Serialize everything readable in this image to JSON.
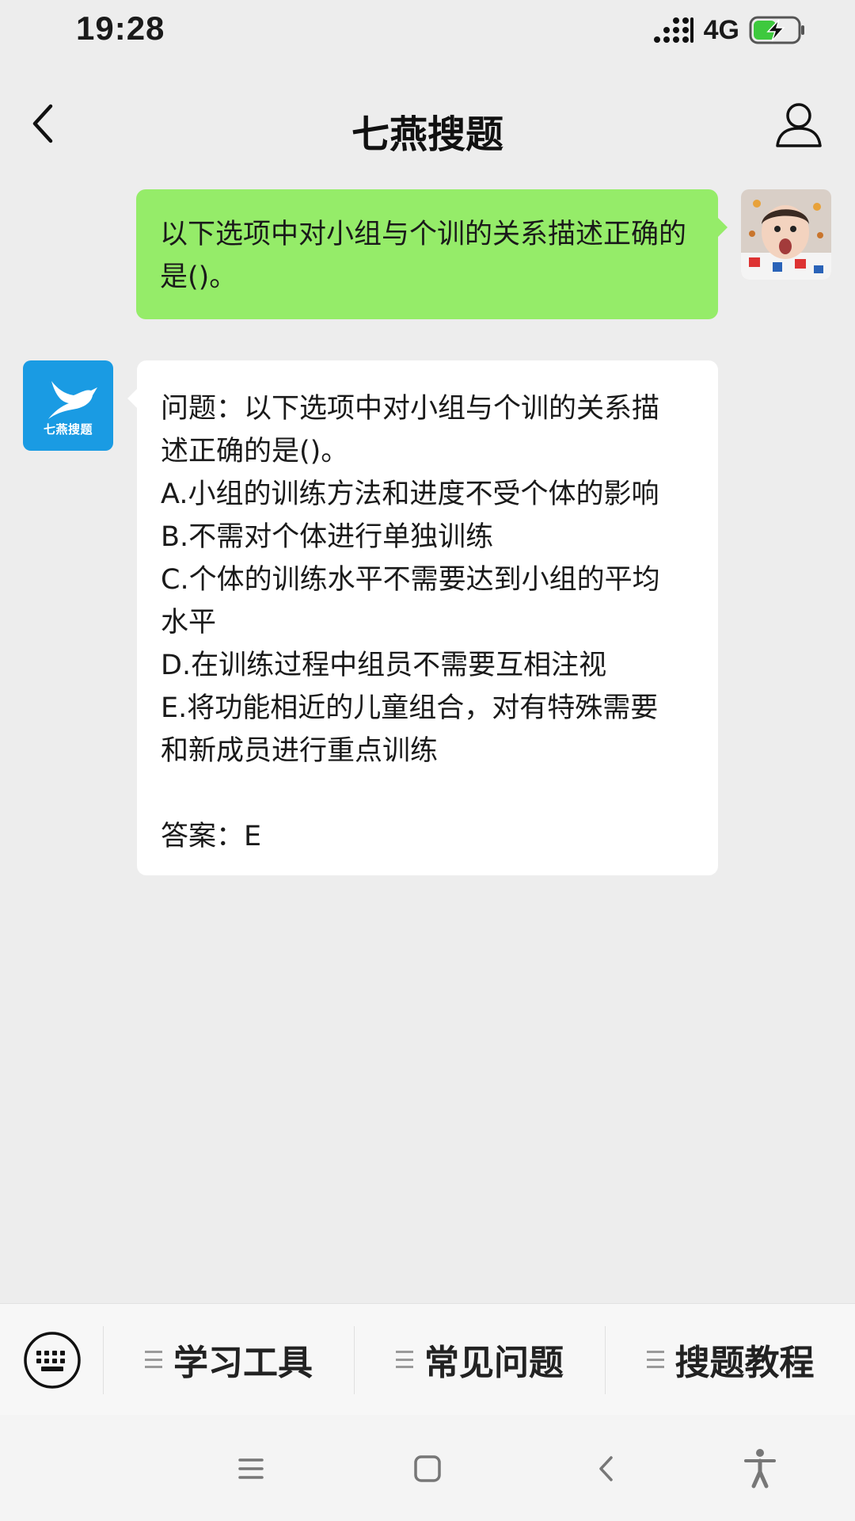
{
  "status_bar": {
    "time": "19:28",
    "network": "4G",
    "icons": [
      "signal-icon",
      "battery-charging-icon"
    ]
  },
  "nav": {
    "title": "七燕搜题",
    "icons": [
      "back-arrow-icon",
      "profile-icon"
    ]
  },
  "chat": {
    "user_message": "以下选项中对小组与个训的关系描述正确的是()。",
    "bot_avatar_label": "七燕搜题",
    "bot_reply": {
      "lines": [
        "问题：以下选项中对小组与个训的关系描",
        "述正确的是()。",
        "A.小组的训练方法和进度不受个体的影响",
        "B.不需对个体进行单独训练",
        "C.个体的训练水平不需要达到小组的平均",
        "水平",
        "D.在训练过程中组员不需要互相注视",
        "E.将功能相近的儿童组合，对有特殊需要",
        "和新成员进行重点训练"
      ],
      "answer": "答案：E"
    }
  },
  "menu": {
    "items": [
      {
        "label": "学习工具"
      },
      {
        "label": "常见问题"
      },
      {
        "label": "搜题教程"
      }
    ],
    "icons": [
      "keyboard-icon",
      "menu-lines-icon"
    ]
  },
  "system_nav": {
    "icons": [
      "recents-icon",
      "home-icon",
      "back-icon",
      "accessibility-icon"
    ]
  },
  "colors": {
    "background": "#ededed",
    "user_bubble": "#95ec69",
    "bot_bubble": "#ffffff",
    "bot_avatar": "#1a9be3",
    "menu_bar": "#f7f7f7"
  }
}
